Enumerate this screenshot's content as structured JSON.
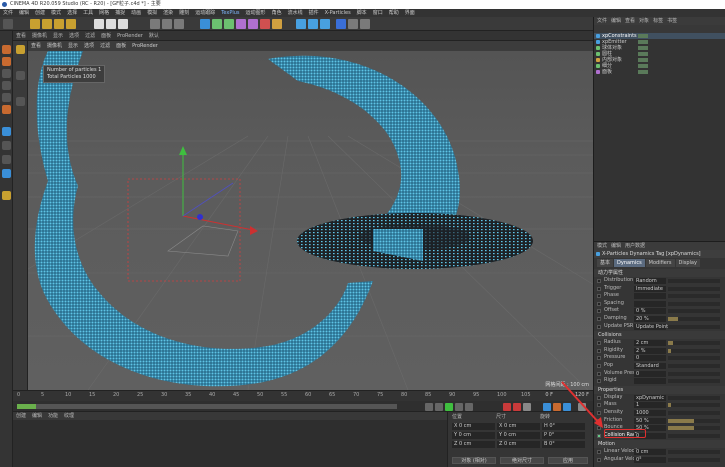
{
  "window": {
    "title": "CINEMA 4D R20.059 Studio (RC - R20) - [GF粒子.c4d *] - 主要"
  },
  "menubar": [
    "文件",
    "编辑",
    "创建",
    "模式",
    "选择",
    "工具",
    "网格",
    "捕捉",
    "动画",
    "模拟",
    "渲染",
    "雕刻",
    "运动跟踪",
    "运动图形",
    "角色",
    "流水线",
    "插件",
    "X-Particles",
    "脚本",
    "窗口",
    "帮助",
    "界面"
  ],
  "menubar_highlight": "TexPlus",
  "toolbar2": [
    "查看",
    "摄像机",
    "显示",
    "选项",
    "过滤",
    "面板",
    "ProRender",
    "默认"
  ],
  "viewport_menu": [
    "查看",
    "摄像机",
    "显示",
    "选项",
    "过滤",
    "面板",
    "ProRender"
  ],
  "hud": {
    "line1": "Number of particles 1",
    "line2": "Total Particles 1000"
  },
  "viewport_footer": "网格间距 : 100 cm",
  "timeline": {
    "ticks": [
      "0",
      "5",
      "10",
      "15",
      "20",
      "25",
      "30",
      "35",
      "40",
      "45",
      "50",
      "55",
      "60",
      "65",
      "70",
      "75",
      "80",
      "85",
      "90",
      "95",
      "100",
      "105",
      "110"
    ],
    "current": "0 F",
    "end": "120 F",
    "progress": 0.05
  },
  "material_manager": {
    "menu": [
      "创建",
      "编辑",
      "功能",
      "纹理"
    ]
  },
  "coord_manager": {
    "headers": [
      "位置",
      "尺寸",
      "旋转"
    ],
    "rows": [
      [
        "X  0 cm",
        "X  0 cm",
        "H  0°"
      ],
      [
        "Y  0 cm",
        "Y  0 cm",
        "P  0°"
      ],
      [
        "Z  0 cm",
        "Z  0 cm",
        "B  0°"
      ]
    ],
    "mode_left": "对象 (相对)",
    "mode_mid": "绝对尺寸",
    "apply": "应用"
  },
  "object_manager": {
    "menu": [
      "文件",
      "编辑",
      "查看",
      "对象",
      "标签",
      "书签"
    ],
    "objects": [
      {
        "name": "xpConstraints",
        "color": "#48a0e0",
        "selected": true
      },
      {
        "name": "xpEmitter",
        "color": "#48a0e0",
        "selected": false
      },
      {
        "name": "球体对象",
        "color": "#6cc070",
        "selected": false
      },
      {
        "name": "圆柱",
        "color": "#6cc070",
        "selected": false
      },
      {
        "name": "内部对象",
        "color": "#d0a040",
        "selected": false
      },
      {
        "name": "细分",
        "color": "#6cc070",
        "selected": false
      },
      {
        "name": "面板",
        "color": "#b070d0",
        "selected": false
      }
    ]
  },
  "attribute_manager": {
    "menu": [
      "模式",
      "编辑",
      "用户数据"
    ],
    "title": "X-Particles Dynamics Tag [xpDynamics]",
    "tabs": [
      "基本",
      "Dynamics",
      "Modifiers",
      "Display"
    ],
    "sections": [
      {
        "title": "动力学属性",
        "rows": [
          {
            "label": "Distribution",
            "value": "Random",
            "bar": 0
          },
          {
            "label": "Trigger",
            "value": "Immediate",
            "bar": 0
          },
          {
            "label": "Phase",
            "value": "",
            "bar": 0
          },
          {
            "label": "Spacing",
            "value": "",
            "bar": 0
          },
          {
            "label": "Offset",
            "value": "0 %",
            "bar": 0
          },
          {
            "label": "Damping",
            "value": "20 %",
            "bar": 0.2
          },
          {
            "label": "Update PSR",
            "value": "Update Points",
            "bar": 0
          }
        ]
      },
      {
        "title": "Collisions",
        "rows": [
          {
            "label": "Radius",
            "value": "2 cm",
            "bar": 0.1
          },
          {
            "label": "Rigidity",
            "value": "2 %",
            "bar": 0.05
          },
          {
            "label": "Pressure",
            "value": "0",
            "bar": 0
          },
          {
            "label": "Pop",
            "value": "Standard",
            "bar": 0
          },
          {
            "label": "Volume Pressure",
            "value": "0",
            "bar": 0
          },
          {
            "label": "Rigid",
            "value": "",
            "bar": 0
          }
        ]
      },
      {
        "title": "Properties",
        "rows": [
          {
            "label": "Display",
            "value": "xpDynamic",
            "bar": 0
          },
          {
            "label": "Mass",
            "value": "1",
            "bar": 0.05
          },
          {
            "label": "Density",
            "value": "1000",
            "bar": 0
          },
          {
            "label": "Friction",
            "value": "50 %",
            "bar": 0.5
          },
          {
            "label": "Bounce",
            "value": "50 %",
            "bar": 0.5
          },
          {
            "label": "Collision Radius",
            "value": "0",
            "bar": 0,
            "highlight": true
          }
        ]
      },
      {
        "title": "Motion",
        "rows": [
          {
            "label": "Linear Velocity",
            "value": "0 cm",
            "bar": 0
          },
          {
            "label": "Angular Velocity",
            "value": "0°",
            "bar": 0
          }
        ]
      }
    ]
  },
  "colors": {
    "particles": "#5ec4e6",
    "accent_red": "#e03030",
    "selection": "#405060"
  }
}
